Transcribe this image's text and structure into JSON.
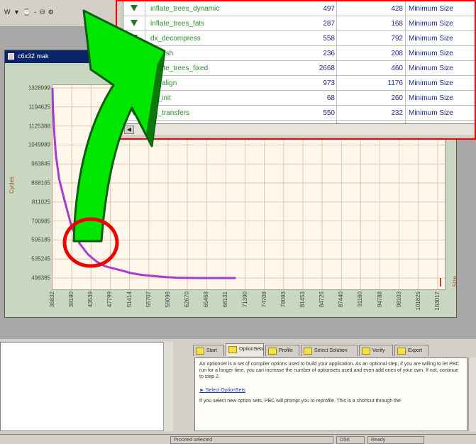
{
  "toolbar": {
    "glyphs": "W ▼ ⌚ - ⛁ ⚙"
  },
  "chart_window": {
    "title": "c6x32 mak"
  },
  "chart_data": {
    "type": "line",
    "ylabel": "Cycles",
    "xlabel": "Size",
    "y_ticks": [
      "1328999",
      "1194625",
      "1125388",
      "1049989",
      "963845",
      "868165",
      "811025",
      "700985",
      "595185",
      "535245",
      "496385"
    ],
    "x_ticks": [
      "35832",
      "39190",
      "43539",
      "47799",
      "51414",
      "55707",
      "59096",
      "62670",
      "65468",
      "68131",
      "71390",
      "74708",
      "78093",
      "81453",
      "84726",
      "87440",
      "91160",
      "94788",
      "98103",
      "101825",
      "103017"
    ],
    "series": [
      {
        "color": "#a83cd0",
        "x": [
          35832,
          35900,
          36100,
          36400,
          37000,
          38000,
          39190,
          40500,
          42000,
          43539,
          45000,
          47799,
          49500,
          51414,
          53500,
          55707,
          57500,
          59096,
          61000,
          62670,
          64000,
          65468,
          66500,
          67800
        ],
        "y": [
          1328999,
          1250000,
          1150000,
          1040000,
          930000,
          830000,
          720000,
          650000,
          600000,
          568000,
          548000,
          530000,
          518000,
          510000,
          505000,
          500000,
          498000,
          497000,
          496500,
          496385,
          496385,
          496385,
          496385,
          496385
        ]
      }
    ]
  },
  "table": {
    "rows": [
      {
        "name": "inflate_trees_dynamic",
        "v1": "497",
        "v2": "428",
        "v3": "Minimum Size"
      },
      {
        "name": "inflate_trees_fats",
        "v1": "287",
        "v2": "168",
        "v3": "Minimum Size"
      },
      {
        "name": "dx_decompress",
        "v1": "558",
        "v2": "792",
        "v3": "Minimum Size"
      },
      {
        "name": "deflush",
        "v1": "236",
        "v2": "208",
        "v3": "Minimum Size"
      },
      {
        "name": "inflate_trees_fixed",
        "v1": "2668",
        "v2": "460",
        "v3": "Minimum Size"
      },
      {
        "name": "ds_align",
        "v1": "973",
        "v2": "1176",
        "v3": "Minimum Size"
      },
      {
        "name": "ds_init",
        "v1": "68",
        "v2": "260",
        "v3": "Minimum Size"
      },
      {
        "name": "ds_transfers",
        "v1": "550",
        "v2": "232",
        "v3": "Minimum Size"
      }
    ]
  },
  "tabs": [
    {
      "label": "Start"
    },
    {
      "label": "OptionSets"
    },
    {
      "label": "Profile"
    },
    {
      "label": "Select Solution"
    },
    {
      "label": "Verify"
    },
    {
      "label": "Export"
    }
  ],
  "help": {
    "p1": "An optionset is a set of compiler options used to build your application. As an optional step, if you are willing to let PBC run for a longer time, you can increase the number of optionsets used and even add ones of your own. If not, continue to step 2.",
    "link": "Select OptionSets",
    "p2": "If you select new option sets, PBC will prompt you to reprofile. This is a shortcut through the"
  },
  "status": {
    "left": "Proceed selected",
    "mid": "DSK",
    "right": "Ready"
  },
  "colors": {
    "accent_red": "#ff0000",
    "arrow_green": "#00e600",
    "curve_purple": "#a83cd0"
  }
}
